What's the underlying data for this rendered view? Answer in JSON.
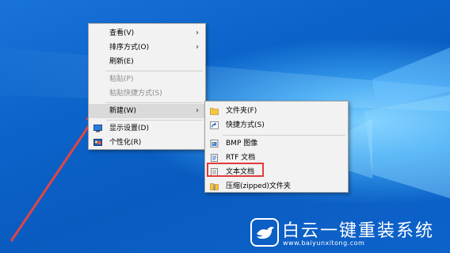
{
  "context_menu": {
    "items": [
      {
        "label": "查看(V)",
        "has_submenu": true
      },
      {
        "label": "排序方式(O)",
        "has_submenu": true
      },
      {
        "label": "刷新(E)"
      },
      {
        "label": "粘贴(P)",
        "disabled": true
      },
      {
        "label": "粘贴快捷方式(S)",
        "disabled": true
      },
      {
        "label": "新建(W)",
        "has_submenu": true,
        "active": true
      },
      {
        "label": "显示设置(D)",
        "icon": "display-icon"
      },
      {
        "label": "个性化(R)",
        "icon": "personalize-icon"
      }
    ]
  },
  "new_submenu": {
    "items": [
      {
        "label": "文件夹(F)",
        "icon": "folder-icon"
      },
      {
        "label": "快捷方式(S)",
        "icon": "shortcut-icon"
      },
      {
        "label": "BMP 图像",
        "icon": "bmp-file-icon"
      },
      {
        "label": "RTF 文档",
        "icon": "rtf-file-icon"
      },
      {
        "label": "文本文档",
        "icon": "text-file-icon",
        "highlighted": true
      },
      {
        "label": "压缩(zipped)文件夹",
        "icon": "zip-folder-icon"
      }
    ]
  },
  "watermark": {
    "brand": "白云一键重装系统",
    "url": "www.baiyunxitong.com"
  },
  "colors": {
    "highlight_box": "#e23b3b",
    "arrow": "#e04545"
  }
}
